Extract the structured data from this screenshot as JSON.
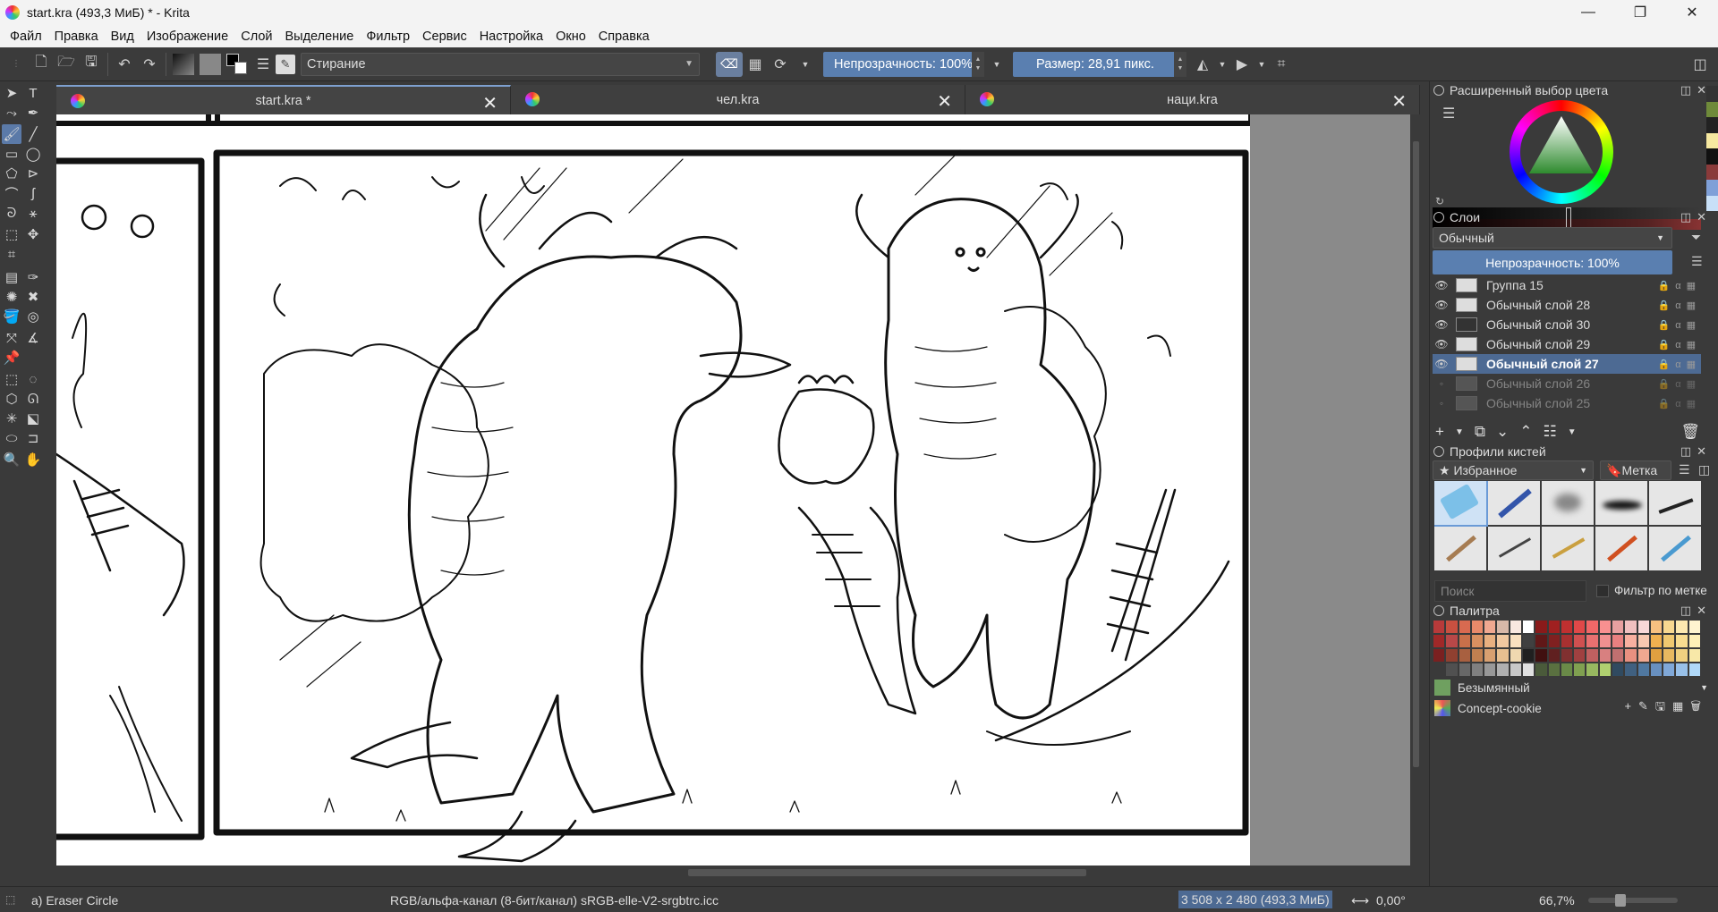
{
  "window": {
    "title": "start.kra (493,3 МиБ)  * - Krita",
    "minimize": "—",
    "maximize": "❐",
    "close": "✕"
  },
  "menu": [
    "Файл",
    "Правка",
    "Вид",
    "Изображение",
    "Слой",
    "Выделение",
    "Фильтр",
    "Сервис",
    "Настройка",
    "Окно",
    "Справка"
  ],
  "toolbar": {
    "brush_preset": "Стирание",
    "opacity_label": "Непрозрачность: 100%",
    "size_label": "Размер: 28,91 пикс."
  },
  "tabs": [
    {
      "label": "start.kra *",
      "active": true
    },
    {
      "label": "чел.kra",
      "active": false
    },
    {
      "label": "наци.kra",
      "active": false
    }
  ],
  "dockers": {
    "color_selector": {
      "title": "Расширенный выбор цвета"
    },
    "layers": {
      "title": "Слои",
      "blend_mode": "Обычный",
      "opacity": "Непрозрачность:  100%",
      "items": [
        {
          "name": "Группа 15",
          "visible": true,
          "selected": false
        },
        {
          "name": "Обычный слой 28",
          "visible": true,
          "selected": false
        },
        {
          "name": "Обычный слой 30",
          "visible": true,
          "selected": false
        },
        {
          "name": "Обычный слой 29",
          "visible": true,
          "selected": false
        },
        {
          "name": "Обычный слой 27",
          "visible": true,
          "selected": true
        },
        {
          "name": "Обычный слой 26",
          "visible": false,
          "selected": false
        },
        {
          "name": "Обычный слой 25",
          "visible": false,
          "selected": false
        }
      ]
    },
    "brushes": {
      "title": "Профили кистей",
      "favorites": "Избранное",
      "tag": "Метка",
      "search_placeholder": "Поиск",
      "filter_label": "Фильтр по метке"
    },
    "palette": {
      "title": "Палитра",
      "palettes": [
        "Безымянный",
        "Concept-cookie"
      ]
    }
  },
  "status": {
    "tool": "а) Eraser Circle",
    "colorspace": "RGB/альфа-канал (8-бит/канал)  sRGB-elle-V2-srgbtrc.icc",
    "dimensions": "3 508 x 2 480 (493,3 МиБ)",
    "rotation": "0,00°",
    "zoom": "66,7%"
  }
}
